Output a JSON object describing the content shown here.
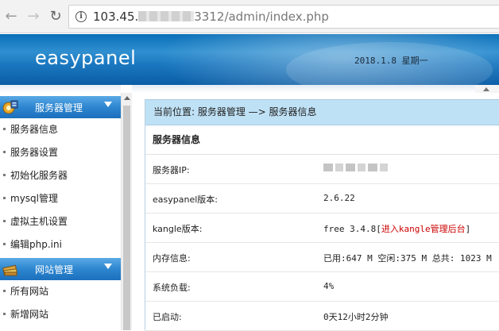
{
  "browser": {
    "url_host_prefix": "103.45.",
    "url_rest": "3312/admin/index.php"
  },
  "header": {
    "brand": "easypanel",
    "date": "2018.1.8 星期一"
  },
  "sidebar": {
    "groups": [
      {
        "title": "服务器管理",
        "items": [
          "服务器信息",
          "服务器设置",
          "初始化服务器",
          "mysql管理",
          "虚拟主机设置",
          "编辑php.ini"
        ]
      },
      {
        "title": "网站管理",
        "items": [
          "所有网站",
          "新增网站"
        ]
      }
    ]
  },
  "main": {
    "breadcrumb": "当前位置: 服务器管理 —> 服务器信息",
    "section_title": "服务器信息",
    "rows": [
      {
        "label": "服务器IP:",
        "value": ""
      },
      {
        "label": "easypanel版本:",
        "value": "2.6.22"
      },
      {
        "label": "kangle版本:",
        "value": "free 3.4.8",
        "link": "进入kangle管理后台",
        "bracket_open": "[",
        "bracket_close": "]"
      },
      {
        "label": "内存信息:",
        "value": "已用:647 M 空闲:375 M 总共: 1023 M"
      },
      {
        "label": "系统负载:",
        "value": "4%"
      },
      {
        "label": "已启动:",
        "value": "0天12小时2分钟"
      }
    ]
  },
  "colors": {
    "banner": "#1a77bf",
    "breadcrumb_bg": "#bfe1f5",
    "menu_head": "#2d86cf",
    "link": "#cc0000"
  },
  "icons": {
    "back": "arrow-left-icon",
    "forward": "arrow-right-icon",
    "reload": "reload-icon",
    "site_info": "info-icon",
    "server_group": "server-gear-icon",
    "site_group": "books-icon",
    "collapse": "triangle-down-icon"
  }
}
